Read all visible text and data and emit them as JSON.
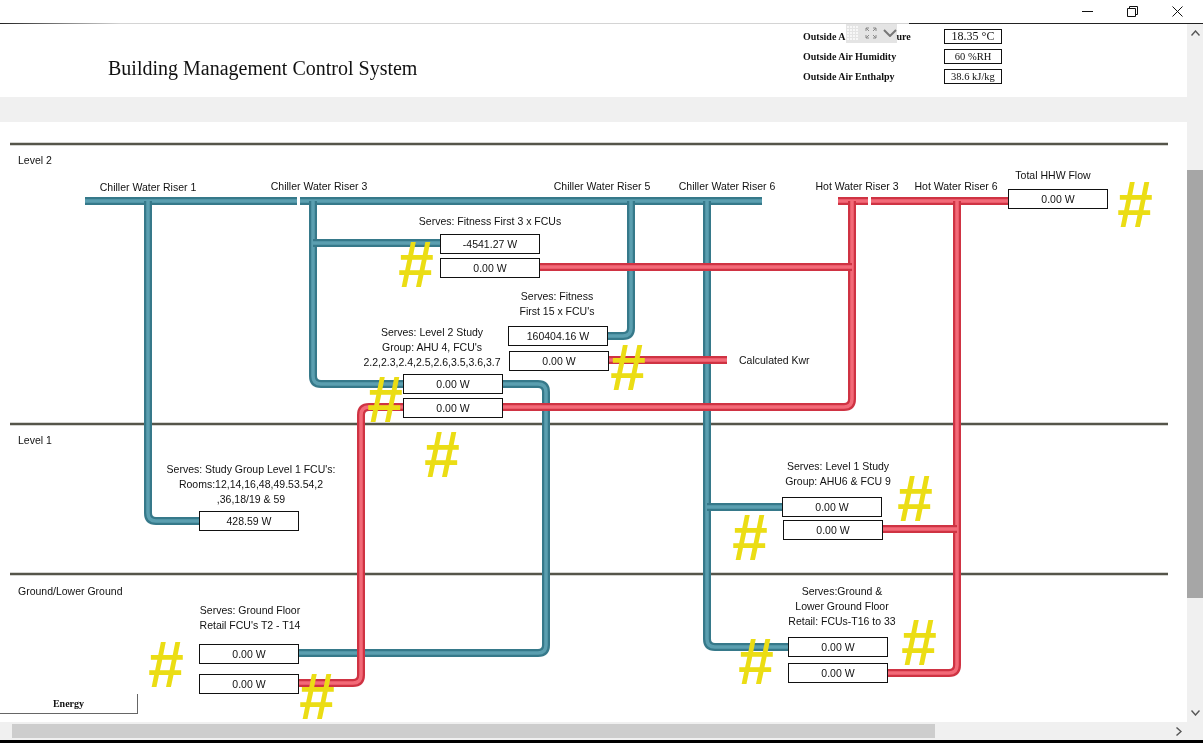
{
  "header": {
    "title": "Building Management Control System",
    "outside_air": [
      {
        "label": "Outside A",
        "label_end": "ure",
        "value": "18.35 °C"
      },
      {
        "label": "Outside Air Humidity",
        "value": "60 %RH"
      },
      {
        "label": "Outside Air Enthalpy",
        "value": "38.6 kJ/kg"
      }
    ]
  },
  "diagram": {
    "levels": [
      "Level 2",
      "Level 1",
      "Ground/Lower Ground"
    ],
    "risers": [
      "Chiller Water Riser 1",
      "Chiller Water Riser 3",
      "Chiller Water Riser 5",
      "Chiller Water Riser 6",
      "Hot Water Riser 3",
      "Hot Water Riser 6"
    ],
    "total_hhw_flow": {
      "label": "Total HHW Flow",
      "value": "0.00 W"
    },
    "loads": [
      {
        "serves": "Serves: Fitness First 3 x FCUs",
        "chilled_water": "-4541.27 W",
        "hot_water": "0.00 W"
      },
      {
        "serves": "Serves: Fitness\nFirst 15 x FCU's",
        "chilled_water": "160404.16 W",
        "hot_water": "0.00 W",
        "note": "Calculated Kwr"
      },
      {
        "serves": "Serves: Level 2 Study\nGroup: AHU 4, FCU's\n2.2,2.3,2.4,2.5,2.6,3.5,3.6,3.7",
        "chilled_water": "0.00 W",
        "hot_water": "0.00 W"
      },
      {
        "serves": "Serves: Study Group Level 1 FCU's:\nRooms:12,14,16,48,49.53.54,2\n,36,18/19 & 59",
        "chilled_water": "428.59 W"
      },
      {
        "serves": "Serves: Level 1 Study\nGroup: AHU6 & FCU 9",
        "chilled_water": "0.00 W",
        "hot_water": "0.00 W"
      },
      {
        "serves": "Serves: Ground Floor\nRetail FCU's T2 - T14",
        "chilled_water": "0.00 W",
        "hot_water": "0.00 W"
      },
      {
        "serves": "Serves:Ground &\nLower Ground Floor\nRetail: FCUs-T16 to 33",
        "chilled_water": "0.00 W",
        "hot_water": "0.00 W"
      }
    ],
    "marks": [
      "#",
      "#",
      "#",
      "#",
      "#",
      "#",
      "#",
      "#",
      "#",
      "#",
      "#"
    ]
  },
  "sheet_tab": "Energy"
}
